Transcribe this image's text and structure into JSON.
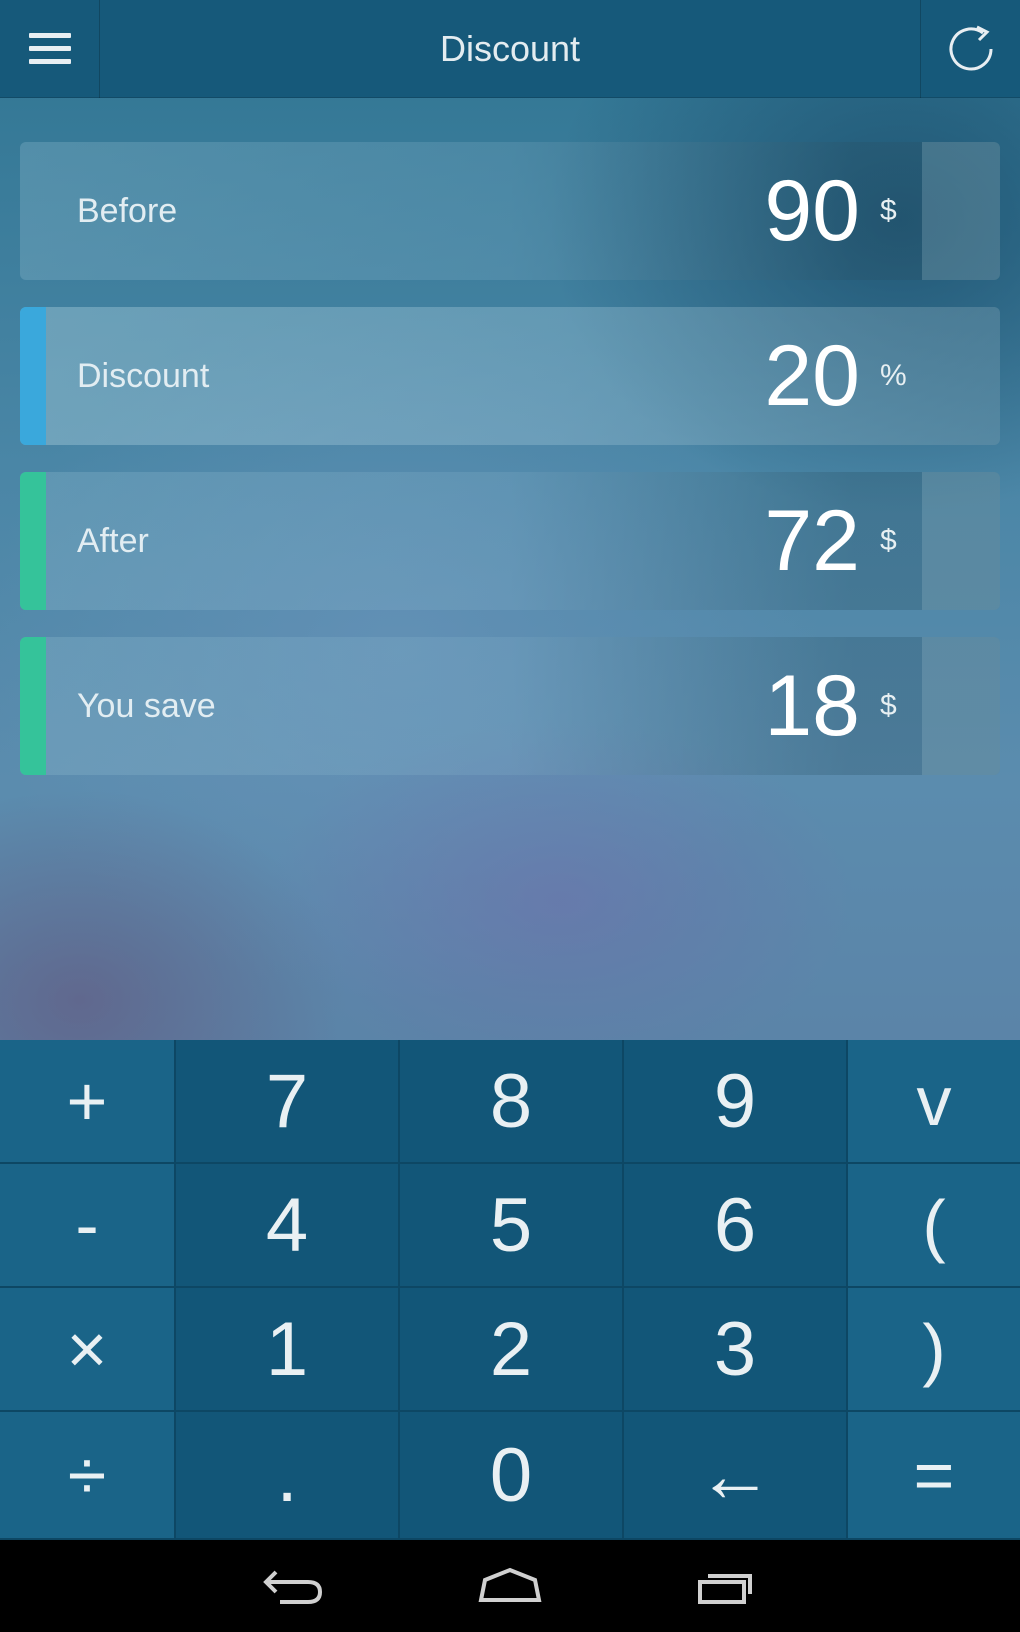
{
  "header": {
    "title": "Discount",
    "menu_icon": "hamburger-menu-icon",
    "refresh_icon": "refresh-icon"
  },
  "rows": [
    {
      "label": "Before",
      "value": "90",
      "unit": "$",
      "accent": ""
    },
    {
      "label": "Discount",
      "value": "20",
      "unit": "%",
      "accent": "#3aa8dc"
    },
    {
      "label": "After",
      "value": "72",
      "unit": "$",
      "accent": "#35c39a"
    },
    {
      "label": "You save",
      "value": "18",
      "unit": "$",
      "accent": "#35c39a"
    }
  ],
  "keypad": {
    "keys": [
      [
        "+",
        "7",
        "8",
        "9",
        "v"
      ],
      [
        "-",
        "4",
        "5",
        "6",
        "("
      ],
      [
        "×",
        "1",
        "2",
        "3",
        ")"
      ],
      [
        "÷",
        ".",
        "0",
        "←",
        "="
      ]
    ]
  },
  "navbar": {
    "back_icon": "back-icon",
    "home_icon": "home-icon",
    "recents_icon": "recents-icon"
  },
  "colors": {
    "topbar": "#16597a",
    "keypad": "#135a7c",
    "accent_blue": "#3aa8dc",
    "accent_green": "#35c39a"
  }
}
